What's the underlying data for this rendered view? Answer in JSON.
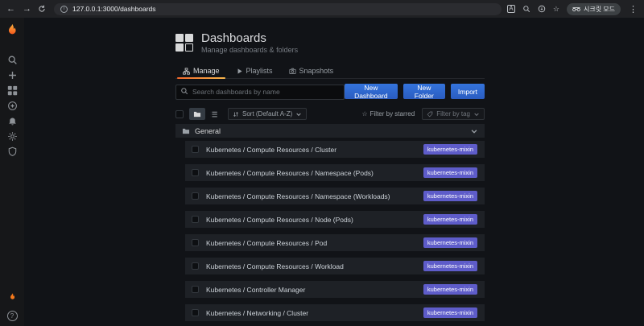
{
  "browser": {
    "url": "127.0.0.1:3000/dashboards",
    "incognito_label": "시크릿 모드",
    "icons": [
      "back-icon",
      "forward-icon",
      "reload-icon",
      "site-info-icon",
      "translate-icon",
      "zoom-icon",
      "install-icon",
      "bookmark-star-icon",
      "menu-icon"
    ]
  },
  "sidebar": {
    "icons": [
      "grafana-logo",
      "search-icon",
      "create-icon",
      "dashboards-icon",
      "explore-icon",
      "alerting-icon",
      "configuration-icon",
      "server-admin-icon",
      "grafana-news-icon",
      "user-avatar"
    ]
  },
  "header": {
    "title": "Dashboards",
    "subtitle": "Manage dashboards & folders"
  },
  "tabs": [
    {
      "label": "Manage",
      "active": true
    },
    {
      "label": "Playlists",
      "active": false
    },
    {
      "label": "Snapshots",
      "active": false
    }
  ],
  "toolbar": {
    "search_placeholder": "Search dashboards by name",
    "new_dashboard_label": "New Dashboard",
    "new_folder_label": "New Folder",
    "import_label": "Import"
  },
  "filters": {
    "sort_label": "Sort (Default A-Z)",
    "starred_label": "Filter by starred",
    "tag_label": "Filter by tag"
  },
  "folder": {
    "name": "General"
  },
  "dashboards": [
    {
      "title": "Kubernetes / Compute Resources / Cluster",
      "tag": "kubernetes-mixin"
    },
    {
      "title": "Kubernetes / Compute Resources / Namespace (Pods)",
      "tag": "kubernetes-mixin"
    },
    {
      "title": "Kubernetes / Compute Resources / Namespace (Workloads)",
      "tag": "kubernetes-mixin"
    },
    {
      "title": "Kubernetes / Compute Resources / Node (Pods)",
      "tag": "kubernetes-mixin"
    },
    {
      "title": "Kubernetes / Compute Resources / Pod",
      "tag": "kubernetes-mixin"
    },
    {
      "title": "Kubernetes / Compute Resources / Workload",
      "tag": "kubernetes-mixin"
    },
    {
      "title": "Kubernetes / Controller Manager",
      "tag": "kubernetes-mixin"
    },
    {
      "title": "Kubernetes / Networking / Cluster",
      "tag": "kubernetes-mixin"
    }
  ],
  "colors": {
    "page_bg": "#111317",
    "card_bg": "#1e2126",
    "accent_orange": "#f2682c",
    "primary_blue": "#2e66d0",
    "tag_purple": "#5e5cc9",
    "browser_bar": "#202124"
  }
}
